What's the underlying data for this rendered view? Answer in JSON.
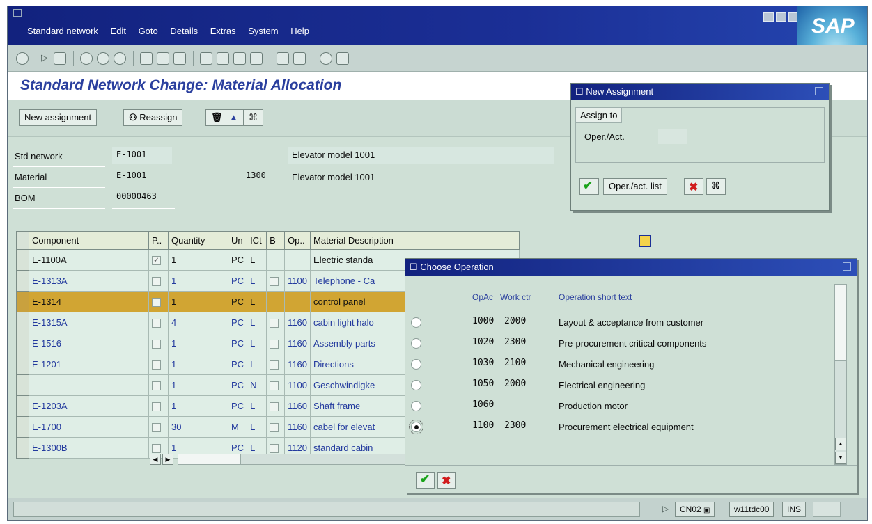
{
  "menu": [
    "Standard network",
    "Edit",
    "Goto",
    "Details",
    "Extras",
    "System",
    "Help"
  ],
  "logo_text": "SAP",
  "page_title": "Standard Network Change: Material Allocation",
  "app_toolbar": {
    "new_assignment": "New assignment",
    "reassign": "Reassign"
  },
  "header": {
    "std_network_label": "Std network",
    "std_network_value": "E-1001",
    "std_network_desc": "Elevator model 1001",
    "material_label": "Material",
    "material_value": "E-1001",
    "material_plant": "1300",
    "material_desc": "Elevator model 1001",
    "bom_label": "BOM",
    "bom_value": "00000463"
  },
  "table": {
    "headers": [
      "Component",
      "P..",
      "Quantity",
      "Un",
      "ICt",
      "B",
      "Op..",
      "Material Description"
    ],
    "rows": [
      {
        "component": "E-1100A",
        "qty": "1",
        "un": "PC",
        "ict": "L",
        "op": "",
        "desc": "Electric standa"
      },
      {
        "component": "E-1313A",
        "qty": "1",
        "un": "PC",
        "ict": "L",
        "op": "1100",
        "desc": "Telephone - Ca"
      },
      {
        "component": "E-1314",
        "qty": "1",
        "un": "PC",
        "ict": "L",
        "op": "",
        "desc": "control panel"
      },
      {
        "component": "E-1315A",
        "qty": "4",
        "un": "PC",
        "ict": "L",
        "op": "1160",
        "desc": "cabin light halo"
      },
      {
        "component": "E-1516",
        "qty": "1",
        "un": "PC",
        "ict": "L",
        "op": "1160",
        "desc": "Assembly parts"
      },
      {
        "component": "E-1201",
        "qty": "1",
        "un": "PC",
        "ict": "L",
        "op": "1160",
        "desc": "Directions"
      },
      {
        "component": "",
        "qty": "1",
        "un": "PC",
        "ict": "N",
        "op": "1100",
        "desc": "Geschwindigke"
      },
      {
        "component": "E-1203A",
        "qty": "1",
        "un": "PC",
        "ict": "L",
        "op": "1160",
        "desc": "Shaft frame"
      },
      {
        "component": "E-1700",
        "qty": "30",
        "un": "M",
        "ict": "L",
        "op": "1160",
        "desc": "cabel for elevat"
      },
      {
        "component": "E-1300B",
        "qty": "1",
        "un": "PC",
        "ict": "L",
        "op": "1120",
        "desc": "standard cabin"
      }
    ]
  },
  "new_assignment_dialog": {
    "title": "New Assignment",
    "group": "Assign to",
    "oper_label": "Oper./Act.",
    "oper_value": "",
    "list_button": "Oper./act. list"
  },
  "choose_operation_dialog": {
    "title": "Choose Operation",
    "headers": [
      "OpAc",
      "Work ctr",
      "Operation short text"
    ],
    "rows": [
      {
        "opac": "1000",
        "work_ctr": "2000",
        "text": "Layout & acceptance from customer"
      },
      {
        "opac": "1020",
        "work_ctr": "2300",
        "text": "Pre-procurement critical components"
      },
      {
        "opac": "1030",
        "work_ctr": "2100",
        "text": "Mechanical engineering"
      },
      {
        "opac": "1050",
        "work_ctr": "2000",
        "text": "Electrical engineering"
      },
      {
        "opac": "1060",
        "work_ctr": "",
        "text": "Production motor"
      },
      {
        "opac": "1100",
        "work_ctr": "2300",
        "text": "Procurement electrical equipment"
      }
    ]
  },
  "status": {
    "transaction": "CN02",
    "server": "w11tdc00",
    "mode": "INS"
  }
}
